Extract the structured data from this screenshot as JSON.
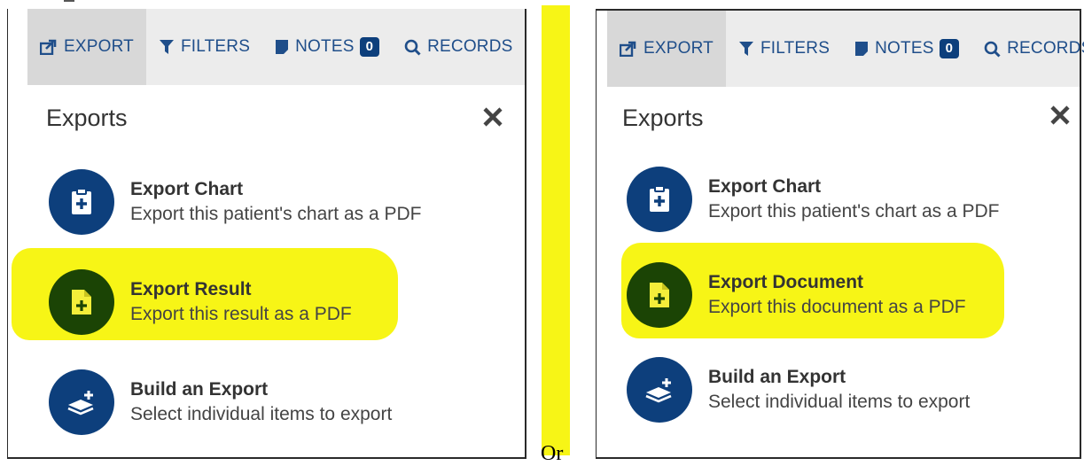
{
  "tabs": [
    {
      "label": "EXPORT",
      "icon": "share-export-icon"
    },
    {
      "label": "FILTERS",
      "icon": "filter-icon"
    },
    {
      "label": "NOTES",
      "icon": "note-icon",
      "badge": "0"
    },
    {
      "label": "RECORDS",
      "icon": "search-icon"
    }
  ],
  "left_panel": {
    "title": "Exports",
    "items": [
      {
        "title": "Export Chart",
        "desc": "Export this patient's chart as a PDF",
        "icon": "clipboard-plus-icon"
      },
      {
        "title": "Export Result",
        "desc": "Export this result as a PDF",
        "icon": "document-plus-icon",
        "highlighted": true
      },
      {
        "title": "Build an Export",
        "desc": "Select individual items to export",
        "icon": "layers-plus-icon"
      }
    ]
  },
  "right_panel": {
    "title": "Exports",
    "items": [
      {
        "title": "Export Chart",
        "desc": "Export this patient's chart as a PDF",
        "icon": "clipboard-plus-icon"
      },
      {
        "title": "Export Document",
        "desc": "Export this document as a PDF",
        "icon": "document-plus-icon",
        "highlighted": true
      },
      {
        "title": "Build an Export",
        "desc": "Select individual items to export",
        "icon": "layers-plus-icon"
      }
    ]
  },
  "separator_text": "Or",
  "colors": {
    "brand_blue": "#0d3f7c",
    "highlight_yellow": "#f7f516",
    "highlighted_icon_bg": "#1b4405",
    "tab_text": "#1f4e8a"
  }
}
